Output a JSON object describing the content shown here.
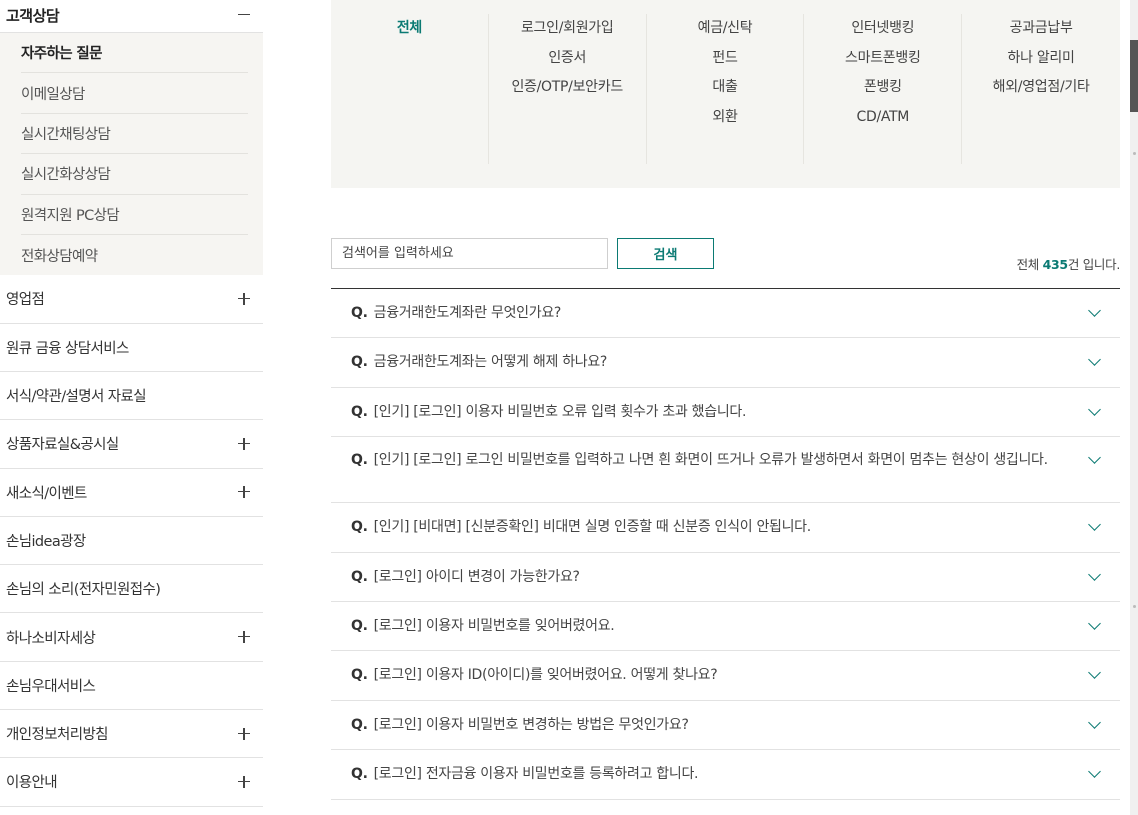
{
  "sidebar": {
    "top_label": "고객상담",
    "submenu": [
      {
        "label": "자주하는 질문",
        "active": true
      },
      {
        "label": "이메일상담",
        "active": false
      },
      {
        "label": "실시간채팅상담",
        "active": false
      },
      {
        "label": "실시간화상상담",
        "active": false
      },
      {
        "label": "원격지원 PC상담",
        "active": false
      },
      {
        "label": "전화상담예약",
        "active": false
      }
    ],
    "items": [
      {
        "label": "영업점",
        "expandable": true
      },
      {
        "label": "원큐 금융 상담서비스",
        "expandable": false
      },
      {
        "label": "서식/약관/설명서 자료실",
        "expandable": false
      },
      {
        "label": "상품자료실&공시실",
        "expandable": true
      },
      {
        "label": "새소식/이벤트",
        "expandable": true
      },
      {
        "label": "손님idea광장",
        "expandable": false
      },
      {
        "label": "손님의 소리(전자민원접수)",
        "expandable": false
      },
      {
        "label": "하나소비자세상",
        "expandable": true
      },
      {
        "label": "손님우대서비스",
        "expandable": false
      },
      {
        "label": "개인정보처리방침",
        "expandable": true
      },
      {
        "label": "이용안내",
        "expandable": true
      }
    ]
  },
  "categories": {
    "columns": [
      [
        "전체"
      ],
      [
        "로그인/회원가입",
        "인증서",
        "인증/OTP/보안카드"
      ],
      [
        "예금/신탁",
        "펀드",
        "대출",
        "외환"
      ],
      [
        "인터넷뱅킹",
        "스마트폰뱅킹",
        "폰뱅킹",
        "CD/ATM"
      ],
      [
        "공과금납부",
        "하나 알리미",
        "해외/영업점/기타"
      ]
    ],
    "selected": "전체"
  },
  "search": {
    "placeholder": "검색어를 입력하세요",
    "button_label": "검색",
    "total_prefix": "전체 ",
    "total_count": "435",
    "total_suffix": "건 입니다."
  },
  "faq": {
    "q_prefix": "Q.",
    "items": [
      "금융거래한도계좌란 무엇인가요?",
      "금융거래한도계좌는 어떻게 해제 하나요?",
      "[인기] [로그인] 이용자 비밀번호 오류 입력 횟수가 초과 했습니다.",
      "[인기] [로그인] 로그인 비밀번호를 입력하고 나면 흰 화면이 뜨거나 오류가 발생하면서 화면이 멈추는 현상이 생깁니다.",
      "[인기] [비대면] [신분증확인] 비대면 실명 인증할 때 신분증 인식이 안됩니다.",
      "[로그인] 아이디 변경이 가능한가요?",
      "[로그인] 이용자 비밀번호를 잊어버렸어요.",
      "[로그인] 이용자 ID(아이디)를 잊어버렸어요. 어떻게 찾나요?",
      "[로그인] 이용자 비밀번호 변경하는 방법은 무엇인가요?",
      "[로그인] 전자금융 이용자 비밀번호를 등록하려고 합니다."
    ]
  },
  "colors": {
    "accent": "#0b7a73"
  }
}
